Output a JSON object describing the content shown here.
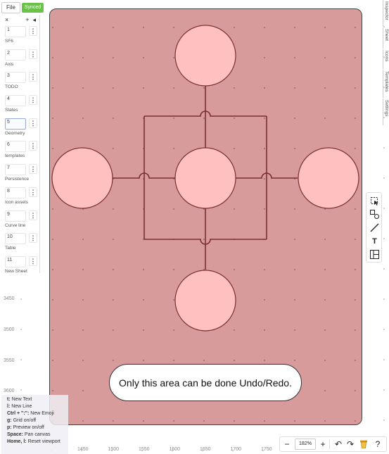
{
  "topbar": {
    "file_label": "File",
    "status": "Synced"
  },
  "sheet_panel": {
    "close_glyph": "×",
    "add_glyph": "+",
    "collapse_glyph": "◂",
    "menu_glyph": "⋮",
    "sheets": [
      {
        "num": "1",
        "name": "SF6",
        "active": false
      },
      {
        "num": "2",
        "name": "Axis",
        "active": false
      },
      {
        "num": "3",
        "name": "TODO",
        "active": false
      },
      {
        "num": "4",
        "name": "States",
        "active": false
      },
      {
        "num": "5",
        "name": "Geometry",
        "active": true
      },
      {
        "num": "6",
        "name": "templates",
        "active": false
      },
      {
        "num": "7",
        "name": "Persistence",
        "active": false
      },
      {
        "num": "8",
        "name": "Icon assets",
        "active": false
      },
      {
        "num": "9",
        "name": "Curve line",
        "active": false
      },
      {
        "num": "10",
        "name": "Table",
        "active": false
      },
      {
        "num": "11",
        "name": "New Sheet",
        "active": false
      }
    ]
  },
  "right_tabs": [
    "Inspector",
    "Sheet",
    "Icons",
    "Templates",
    "Settings"
  ],
  "tools": [
    {
      "name": "select-tool",
      "icon": "select-icon"
    },
    {
      "name": "shape-tool",
      "icon": "shapes-icon"
    },
    {
      "name": "line-tool",
      "icon": "line-icon"
    },
    {
      "name": "text-tool",
      "icon": "text-icon",
      "glyph": "T"
    },
    {
      "name": "template-tool",
      "icon": "template-icon"
    }
  ],
  "y_axis_labels": [
    "3450",
    "3500",
    "3550",
    "3600"
  ],
  "x_axis_labels": [
    "1450",
    "1500",
    "1550",
    "1600",
    "1650",
    "1700",
    "1750"
  ],
  "shortcuts": [
    {
      "key": "t:",
      "desc": "New Text"
    },
    {
      "key": "l:",
      "desc": "New Line"
    },
    {
      "key": "Ctrl + \":\":",
      "desc": "New Emoji"
    },
    {
      "key": "g:",
      "desc": "Grid on/off"
    },
    {
      "key": "p:",
      "desc": "Preview on/off"
    },
    {
      "key": "Space:",
      "desc": "Pan canvas"
    },
    {
      "key": "Home, l:",
      "desc": "Reset viewport"
    }
  ],
  "bottombar": {
    "zoom_out": "−",
    "zoom_level": "182%",
    "zoom_in": "+",
    "undo": "↶",
    "redo": "↷",
    "help": "?"
  },
  "message": "Only this area can be done Undo/Redo.",
  "colors": {
    "board_fill": "#d89b9b",
    "node_fill": "#ffc0c0",
    "wire": "#7a2e2e",
    "synced_green": "#6cc14b"
  }
}
